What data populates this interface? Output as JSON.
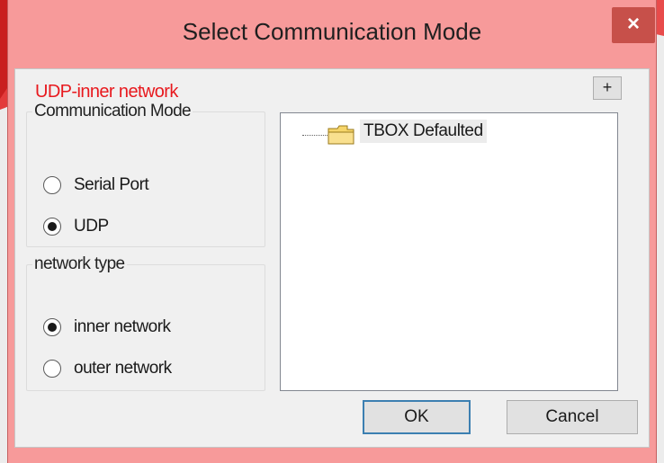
{
  "dialog": {
    "title": "Select Communication Mode",
    "close_label": "×",
    "status_text": "UDP-inner network",
    "add_label": "+"
  },
  "communication_mode": {
    "legend": "Communication Mode",
    "options": [
      {
        "label": "Serial Port",
        "checked": false
      },
      {
        "label": "UDP",
        "checked": true
      }
    ]
  },
  "network_type": {
    "legend": "network type",
    "options": [
      {
        "label": "inner network",
        "checked": true
      },
      {
        "label": "outer network",
        "checked": false
      }
    ]
  },
  "tree": {
    "items": [
      {
        "label": "TBOX Defaulted",
        "icon": "folder-icon"
      }
    ]
  },
  "buttons": {
    "ok_label": "OK",
    "cancel_label": "Cancel"
  },
  "colors": {
    "status_text": "#e8191e",
    "title_bar": "#f79a9a",
    "close_button": "#c7504a",
    "default_button_border": "#3c7fb1"
  }
}
